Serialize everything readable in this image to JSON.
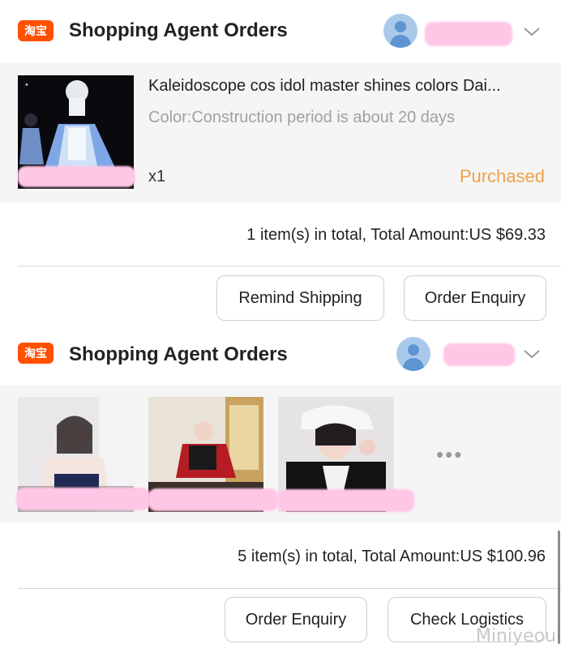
{
  "orders": [
    {
      "store_logo_text": "淘宝",
      "header_title": "Shopping Agent Orders",
      "avatar_icon": "user-avatar-icon",
      "product": {
        "title": "Kaleidoscope cos idol master shines colors Dai...",
        "spec": "Color:Construction period is about 20 days",
        "quantity": "x1",
        "status": "Purchased"
      },
      "summary": "1 item(s) in total, Total Amount:US $69.33",
      "buttons": [
        "Remind Shipping",
        "Order Enquiry"
      ]
    },
    {
      "store_logo_text": "淘宝",
      "header_title": "Shopping Agent Orders",
      "avatar_icon": "user-avatar-icon",
      "more_indicator": "•••",
      "summary": "5 item(s) in total, Total Amount:US $100.96",
      "buttons": [
        "Order Enquiry",
        "Check Logistics"
      ]
    }
  ],
  "watermark": "Miniyeou",
  "colors": {
    "brand_orange": "#ff5000",
    "status_orange": "#f0a04a",
    "panel_bg": "#f5f5f5",
    "redaction_pink": "#ffc6e6"
  }
}
